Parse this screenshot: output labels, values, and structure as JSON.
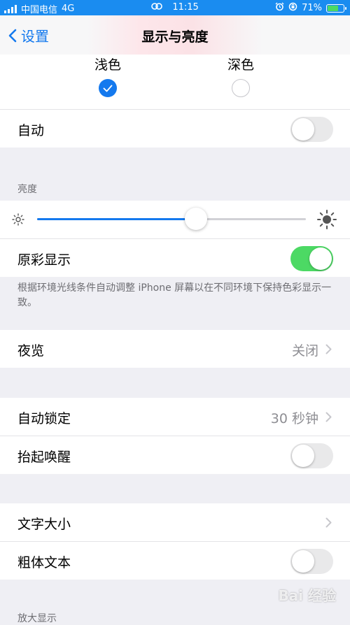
{
  "status": {
    "carrier": "中国电信",
    "network": "4G",
    "time": "11:15",
    "battery_percent": "71%",
    "battery_level": 0.71
  },
  "nav": {
    "back_label": "设置",
    "title": "显示与亮度"
  },
  "appearance": {
    "light_label": "浅色",
    "dark_label": "深色",
    "selected": "light",
    "auto_label": "自动",
    "auto_on": false
  },
  "brightness": {
    "header": "亮度",
    "level": 0.59,
    "true_tone_label": "原彩显示",
    "true_tone_on": true,
    "true_tone_note": "根据环境光线条件自动调整 iPhone 屏幕以在不同环境下保持色彩显示一致。"
  },
  "night_shift": {
    "label": "夜览",
    "value": "关闭"
  },
  "lock": {
    "auto_lock_label": "自动锁定",
    "auto_lock_value": "30 秒钟",
    "raise_to_wake_label": "抬起唤醒",
    "raise_to_wake_on": false
  },
  "text": {
    "text_size_label": "文字大小",
    "bold_text_label": "粗体文本",
    "bold_text_on": false
  },
  "zoom": {
    "header": "放大显示"
  },
  "watermark": "Bai 经验"
}
